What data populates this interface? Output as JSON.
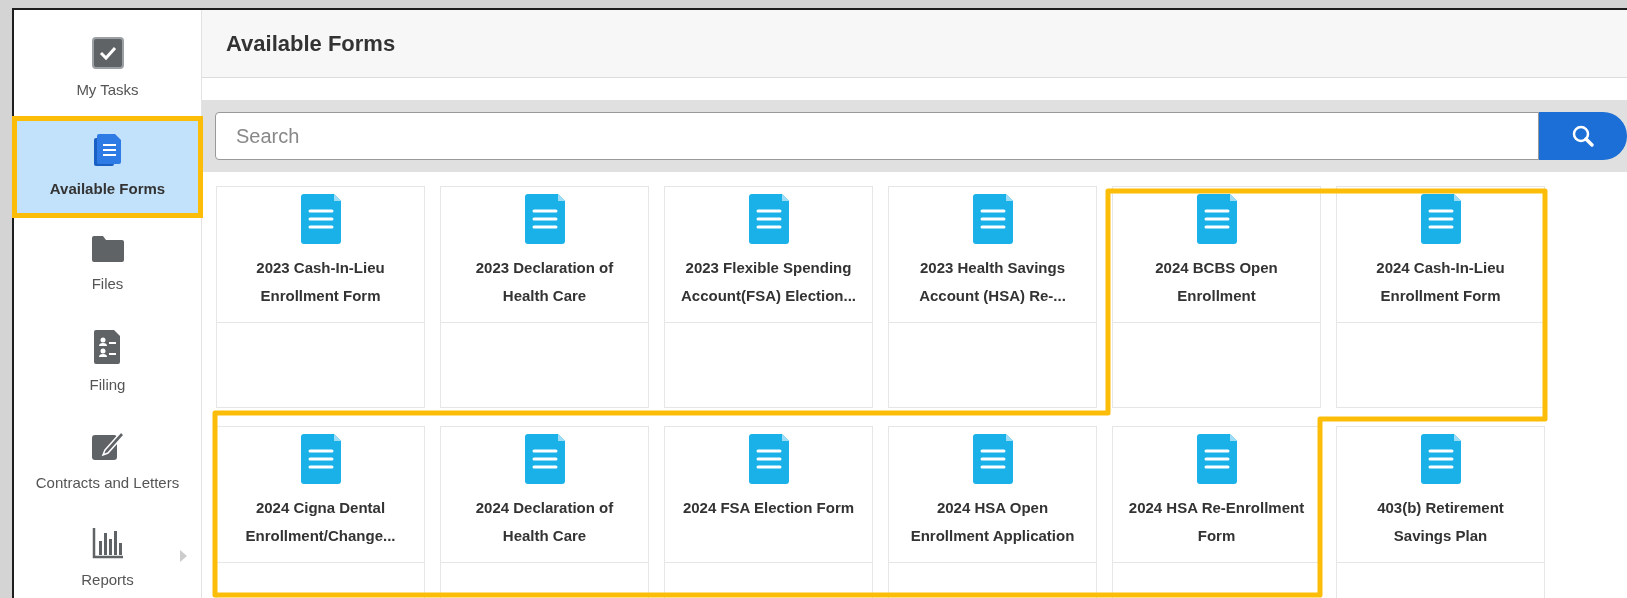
{
  "sidebar": {
    "items": [
      {
        "label": "My Tasks",
        "kind": "check",
        "selected": false,
        "highlighted": false,
        "has_submenu": false
      },
      {
        "label": "Available Forms",
        "kind": "forms",
        "selected": true,
        "highlighted": true,
        "has_submenu": false
      },
      {
        "label": "Files",
        "kind": "folder",
        "selected": false,
        "highlighted": false,
        "has_submenu": false
      },
      {
        "label": "Filing",
        "kind": "filing",
        "selected": false,
        "highlighted": false,
        "has_submenu": false
      },
      {
        "label": "Contracts and Letters",
        "kind": "edit",
        "selected": false,
        "highlighted": false,
        "has_submenu": false
      },
      {
        "label": "Reports",
        "kind": "chart",
        "selected": false,
        "highlighted": false,
        "has_submenu": true
      }
    ]
  },
  "header": {
    "title": "Available Forms"
  },
  "search": {
    "placeholder": "Search"
  },
  "forms": [
    {
      "title": "2023 Cash-In-Lieu Enrollment Form"
    },
    {
      "title": "2023 Declaration of Health Care"
    },
    {
      "title": "2023 Flexible Spending Account(FSA) Election..."
    },
    {
      "title": "2023 Health Savings Account (HSA) Re-..."
    },
    {
      "title": "2024 BCBS Open Enrollment"
    },
    {
      "title": "2024 Cash-In-Lieu Enrollment Form"
    },
    {
      "title": "2024 Cigna Dental Enrollment/Change..."
    },
    {
      "title": "2024 Declaration of Health Care"
    },
    {
      "title": "2024 FSA Election Form"
    },
    {
      "title": "2024 HSA Open Enrollment Application"
    },
    {
      "title": "2024 HSA Re-Enrollment Form"
    },
    {
      "title": "403(b) Retirement Savings Plan"
    }
  ],
  "annotations": [
    {
      "kind": "outline"
    }
  ]
}
